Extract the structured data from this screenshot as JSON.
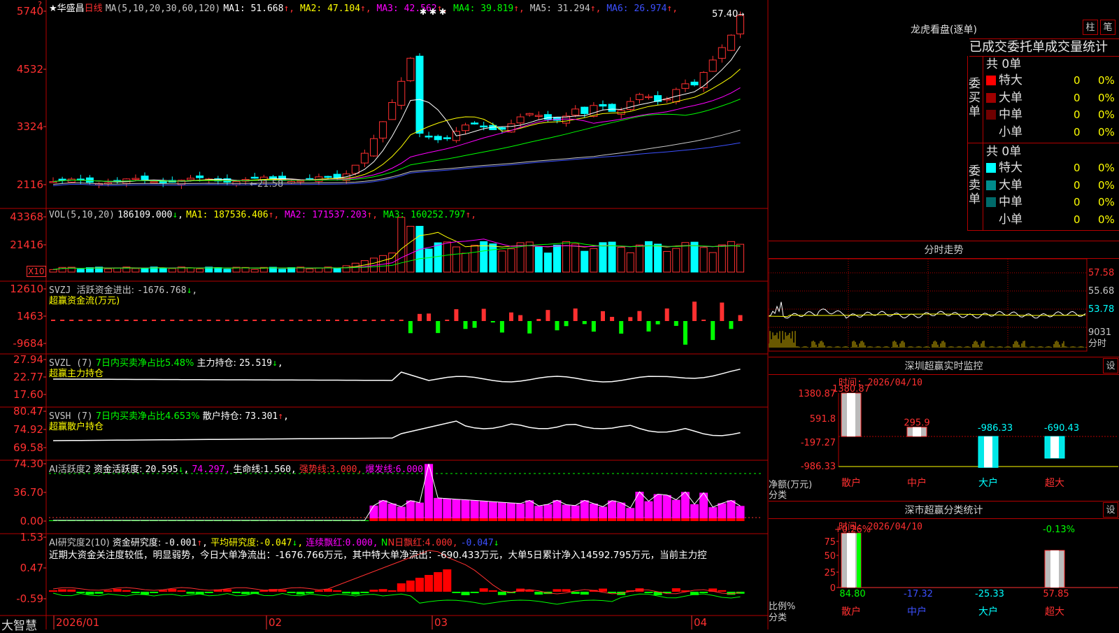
{
  "stock": {
    "name": "华盛昌",
    "period": "日线",
    "star": "★"
  },
  "price_panel": {
    "ma_label": "MA(5,10,20,30,60,120)",
    "ma": [
      {
        "label": "MA1:",
        "value": "51.668",
        "arrow": "↑",
        "color": "#ffffff"
      },
      {
        "label": "MA2:",
        "value": "47.104",
        "arrow": "↑",
        "color": "#ffff00"
      },
      {
        "label": "MA3:",
        "value": "42.562",
        "arrow": "↑",
        "color": "#ff00ff"
      },
      {
        "label": "MA4:",
        "value": "39.819",
        "arrow": "↑",
        "color": "#00ff00"
      },
      {
        "label": "MA5:",
        "value": "31.294",
        "arrow": "↑",
        "color": "#c8c8c8"
      },
      {
        "label": "MA6:",
        "value": "26.974",
        "arrow": "↑",
        "color": "#3c50ff"
      }
    ],
    "stars": "✱✱✱",
    "y_ticks": [
      "5740",
      "4532",
      "3324",
      "2116"
    ],
    "high_marker": "57.40",
    "low_marker": "21.58"
  },
  "vol_panel": {
    "label": "VOL(5,10,20)",
    "value": "186109.000",
    "ma": [
      {
        "label": "MA1:",
        "value": "187536.406",
        "arrow": "↑",
        "color": "#ffff00"
      },
      {
        "label": "MA2:",
        "value": "171537.203",
        "arrow": "↑",
        "color": "#ff00ff"
      },
      {
        "label": "MA3:",
        "value": "160252.797",
        "arrow": "↑",
        "color": "#00ff00"
      }
    ],
    "y_ticks": [
      "43368",
      "21416"
    ],
    "unit": "X10"
  },
  "svzj_panel": {
    "label": "SVZJ",
    "desc": "活跃资金进出:",
    "value": "-1676.768",
    "subtitle": "超赢资金流(万元)",
    "y_ticks": [
      "12610",
      "1463",
      "-9684"
    ]
  },
  "svzl_panel": {
    "label": "SVZL (7)",
    "desc": "7日内买卖净占比5.48%",
    "desc2": "主力持仓:",
    "value": "25.519",
    "subtitle": "超赢主力持仓",
    "y_ticks": [
      "27.94",
      "22.77",
      "17.60"
    ]
  },
  "svsh_panel": {
    "label": "SVSH (7)",
    "desc": "7日内买卖净占比4.653%",
    "desc2": "散户持仓:",
    "value": "73.301",
    "subtitle": "超赢散户持仓",
    "y_ticks": [
      "80.47",
      "74.92",
      "69.58"
    ]
  },
  "ai1_panel": {
    "label": "AI活跃度2",
    "desc": "资金活跃度:",
    "v1": "20.595",
    "v2": "74.297,",
    "life_label": "生命线:",
    "life": "1.560,",
    "strong_label": "强势线:",
    "strong": "3.000,",
    "burst_label": "爆发线:",
    "burst": "6.000,",
    "y_ticks": [
      "74.30",
      "36.70",
      "0.00"
    ]
  },
  "ai2_panel": {
    "label": "AI研究度2(10)",
    "desc": "资金研究度:",
    "v1": "-0.001",
    "avg_label": "平均研究度:",
    "avg": "-0.047",
    "red_label": "连续飘红:",
    "red": "0.000,",
    "n_label": "N日飘红:",
    "n": "4.000,",
    "last": "-0.047",
    "comment": "近期大资金关注度较低，明显弱势，今日大单净流出：-1676.766万元，其中特大单净流出：-690.433万元，大单5日累计净入14592.795万元，当前主力控",
    "y_ticks": [
      "1.53",
      "0.47",
      "-0.59"
    ]
  },
  "x_axis": {
    "labels": [
      "2026/01",
      "02",
      "03",
      "04"
    ]
  },
  "logo": "大智慧",
  "right": {
    "title": "龙虎看盘(逐单)",
    "btn1": "柱",
    "btn2": "笔",
    "tabs": "已成交委托单成交量统计",
    "buy_side": {
      "vertical": "委买单",
      "total": "共 0单",
      "rows": [
        {
          "name": "特大",
          "color": "#ff0000",
          "count": "0",
          "pct": "0%"
        },
        {
          "name": "大单",
          "color": "#a00000",
          "count": "0",
          "pct": "0%"
        },
        {
          "name": "中单",
          "color": "#700000",
          "count": "0",
          "pct": "0%"
        },
        {
          "name": "小单",
          "color": "#000000",
          "count": "0",
          "pct": "0%"
        }
      ]
    },
    "sell_side": {
      "vertical": "委卖单",
      "total": "共 0单",
      "rows": [
        {
          "name": "特大",
          "color": "#00ffff",
          "count": "0",
          "pct": "0%"
        },
        {
          "name": "大单",
          "color": "#008c8c",
          "count": "0",
          "pct": "0%"
        },
        {
          "name": "中单",
          "color": "#006a6a",
          "count": "0",
          "pct": "0%"
        },
        {
          "name": "小单",
          "color": "#000000",
          "count": "0",
          "pct": "0%"
        }
      ]
    },
    "intraday": {
      "title": "分时走势",
      "y_ticks": [
        "57.58",
        "55.68",
        "53.78"
      ],
      "vol_tick": "9031",
      "vol_label": "分时"
    },
    "monitor": {
      "title": "深圳超赢实时监控",
      "set": "设",
      "time": "时间: 2026/04/10",
      "y_ticks": [
        "1380.87",
        "591.8",
        "-197.27",
        "-986.33"
      ],
      "y_label": "净额(万元)",
      "x_label": "分类",
      "categories": [
        "散户",
        "中户",
        "大户",
        "超大"
      ],
      "values": [
        1380.87,
        295.9,
        -986.33,
        -690.43
      ],
      "value_labels": [
        "1380.87",
        "295.9",
        "-986.33",
        "-690.43"
      ]
    },
    "classify": {
      "title": "深市超赢分类统计",
      "set": "设",
      "time": "时间: 2026/04/10",
      "y_ticks": [
        "75",
        "50",
        "25",
        "0"
      ],
      "y_label": "比例%",
      "x_label": "分类",
      "categories": [
        "散户",
        "中户",
        "大户",
        "超大"
      ],
      "pct_top": [
        "+0.26%",
        "",
        "",
        "-0.13%"
      ],
      "bottom_values": [
        "84.80",
        "-17.32",
        "-25.33",
        "57.85"
      ],
      "heights": [
        84.8,
        0,
        0,
        57.85
      ]
    }
  }
}
